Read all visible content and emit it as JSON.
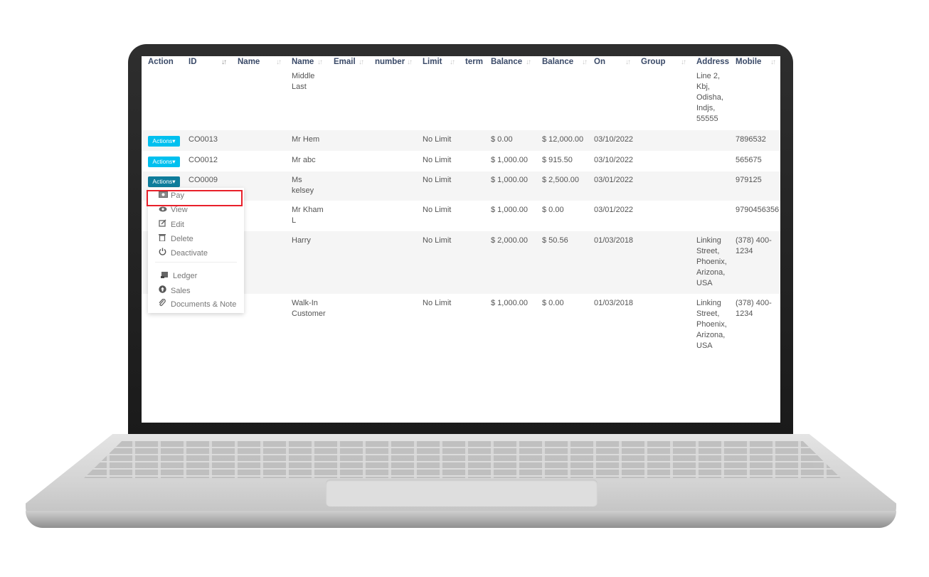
{
  "table": {
    "headers": [
      "Action",
      "ID",
      "Name",
      "Name",
      "Email",
      "number",
      "Limit",
      "term",
      "Balance",
      "Balance",
      "On",
      "Group",
      "Address",
      "Mobile"
    ],
    "sort_icon": "sort-icon",
    "partial_row": {
      "name": [
        "Middle",
        "Last"
      ],
      "address": [
        "Line 2,",
        "Kbj,",
        "Odisha,",
        "Indjs,",
        "55555"
      ]
    },
    "rows": [
      {
        "action": "Actions▾",
        "id": "CO0013",
        "name": [
          "Mr Hem"
        ],
        "limit": "No Limit",
        "bal1": "$ 0.00",
        "bal2": "$ 12,000.00",
        "date": "03/10/2022",
        "address": [],
        "mobile": [
          "7896532"
        ]
      },
      {
        "action": "Actions▾",
        "id": "CO0012",
        "name": [
          "Mr abc"
        ],
        "limit": "No Limit",
        "bal1": "$ 1,000.00",
        "bal2": "$ 915.50",
        "date": "03/10/2022",
        "address": [],
        "mobile": [
          "565675"
        ]
      },
      {
        "action": "Actions▾",
        "id": "CO0009",
        "name": [
          "Ms",
          "kelsey"
        ],
        "limit": "No Limit",
        "bal1": "$ 1,000.00",
        "bal2": "$ 2,500.00",
        "date": "03/01/2022",
        "address": [],
        "mobile": [
          "979125"
        ]
      },
      {
        "action": "",
        "id": "",
        "name": [
          "Mr Kham",
          "L"
        ],
        "limit": "No Limit",
        "bal1": "$ 1,000.00",
        "bal2": "$ 0.00",
        "date": "03/01/2022",
        "address": [],
        "mobile": [
          "9790456356"
        ]
      },
      {
        "action": "",
        "id": "",
        "name": [
          "Harry"
        ],
        "limit": "No Limit",
        "bal1": "$ 2,000.00",
        "bal2": "$ 50.56",
        "date": "01/03/2018",
        "address": [
          "Linking",
          "Street,",
          "Phoenix,",
          "Arizona,",
          "USA"
        ],
        "mobile": [
          "(378) 400-",
          "1234"
        ]
      },
      {
        "action": "",
        "id": "",
        "name": [
          "Walk-In",
          "Customer"
        ],
        "limit": "No Limit",
        "bal1": "$ 1,000.00",
        "bal2": "$ 0.00",
        "date": "01/03/2018",
        "address": [
          "Linking",
          "Street,",
          "Phoenix,",
          "Arizona,",
          "USA"
        ],
        "mobile": [
          "(378) 400-",
          "1234"
        ]
      }
    ]
  },
  "dropdown": {
    "items": [
      {
        "label": "Pay",
        "icon": "money-icon"
      },
      {
        "label": "View",
        "icon": "eye-icon"
      },
      {
        "label": "Edit",
        "icon": "edit-icon"
      },
      {
        "label": "Delete",
        "icon": "trash-icon"
      },
      {
        "label": "Deactivate",
        "icon": "power-icon"
      },
      {
        "label": "Ledger",
        "icon": "scroll-icon"
      },
      {
        "label": "Sales",
        "icon": "arrow-circle-up-icon"
      },
      {
        "label": "Documents & Note",
        "icon": "paperclip-icon"
      }
    ]
  },
  "colors": {
    "accent": "#00c0ef",
    "accent_open": "#0e7c9b",
    "highlight": "#e8202a",
    "header_text": "#3a4a68"
  }
}
